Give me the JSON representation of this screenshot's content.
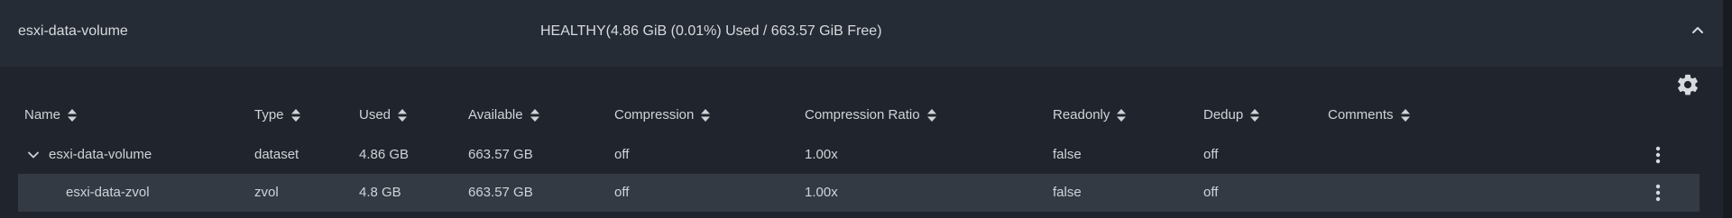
{
  "pool": {
    "name": "esxi-data-volume",
    "status": "HEALTHY(4.86 GiB (0.01%) Used / 663.57 GiB Free)"
  },
  "columns": [
    "Name",
    "Type",
    "Used",
    "Available",
    "Compression",
    "Compression Ratio",
    "Readonly",
    "Dedup",
    "Comments"
  ],
  "rows": [
    {
      "name": "esxi-data-volume",
      "type": "dataset",
      "used": "4.86 GB",
      "available": "663.57 GB",
      "compression": "off",
      "ratio": "1.00x",
      "readonly": "false",
      "dedup": "off",
      "comments": ""
    },
    {
      "name": "esxi-data-zvol",
      "type": "zvol",
      "used": "4.8 GB",
      "available": "663.57 GB",
      "compression": "off",
      "ratio": "1.00x",
      "readonly": "false",
      "dedup": "off",
      "comments": ""
    }
  ],
  "icons": {
    "collapse": "chevron-up-icon",
    "settings": "gear-icon",
    "sort": "sort-icon",
    "expand": "chevron-down-icon",
    "actions": "more-vertical-icon"
  }
}
